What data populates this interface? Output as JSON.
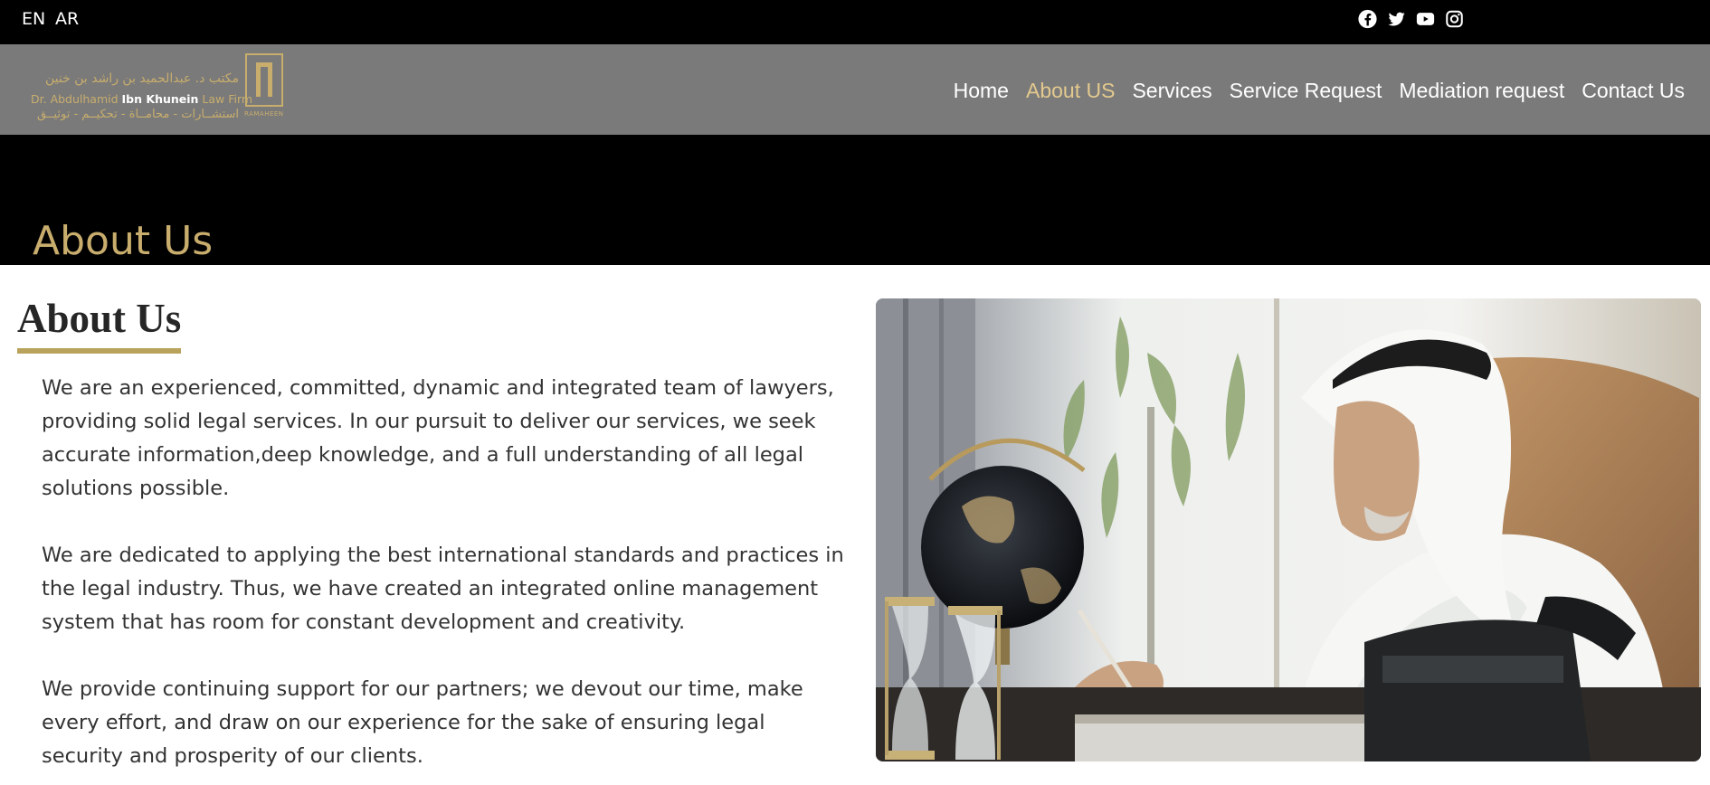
{
  "topbar": {
    "languages": [
      {
        "code": "EN"
      },
      {
        "code": "AR"
      }
    ],
    "social": [
      "facebook-icon",
      "twitter-icon",
      "youtube-icon",
      "instagram-icon"
    ]
  },
  "logo": {
    "arabic_name": "مكتب د. عبدالحميد بن راشد بن خنين",
    "english_name_prefix": "Dr. Abdulhamid ",
    "english_name_bold": "Ibn Khunein",
    "english_name_suffix": " Law Firm",
    "arabic_services": "استشــارات - محامــاة - تحكيــم - توثيــق",
    "mark_caption": "RAMAHEEN"
  },
  "nav": {
    "items": [
      {
        "label": "Home",
        "active": false
      },
      {
        "label": "About US",
        "active": true
      },
      {
        "label": "Services",
        "active": false
      },
      {
        "label": "Service Request",
        "active": false
      },
      {
        "label": "Mediation request",
        "active": false
      },
      {
        "label": "Contact Us",
        "active": false
      }
    ]
  },
  "hero": {
    "title": "About Us"
  },
  "main": {
    "heading": "About Us",
    "paragraphs": [
      "We are an experienced, committed, dynamic and integrated team of lawyers, providing solid legal services. In our pursuit to deliver our services, we seek accurate information,deep knowledge, and a full understanding of all legal solutions possible.",
      "We are dedicated to applying the best international standards and practices in the legal industry. Thus, we have created an integrated online management system that has room for constant development and creativity.",
      "We provide continuing support for our partners; we devout our time, make every effort, and draw on our experience for the sake of ensuring legal security and prosperity of our clients."
    ]
  },
  "colors": {
    "gold": "#c8ad6d",
    "nav_active": "#e3c98e",
    "nav_bg": "#7a7a7a",
    "bar_bg": "#000000"
  }
}
